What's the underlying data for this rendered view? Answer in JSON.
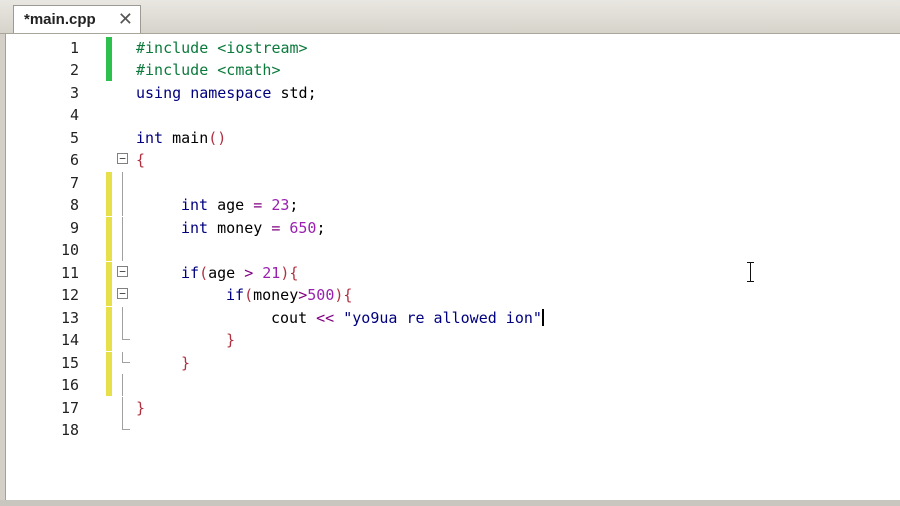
{
  "tab": {
    "title": "*main.cpp",
    "close_glyph": "✕"
  },
  "lines": [
    {
      "n": "1",
      "marker": "green"
    },
    {
      "n": "2",
      "marker": "green"
    },
    {
      "n": "3",
      "marker": ""
    },
    {
      "n": "4",
      "marker": ""
    },
    {
      "n": "5",
      "marker": ""
    },
    {
      "n": "6",
      "marker": ""
    },
    {
      "n": "7",
      "marker": "yellow"
    },
    {
      "n": "8",
      "marker": "yellow"
    },
    {
      "n": "9",
      "marker": "yellow"
    },
    {
      "n": "10",
      "marker": "yellow"
    },
    {
      "n": "11",
      "marker": "yellow"
    },
    {
      "n": "12",
      "marker": "yellow"
    },
    {
      "n": "13",
      "marker": "yellow"
    },
    {
      "n": "14",
      "marker": "yellow"
    },
    {
      "n": "15",
      "marker": "yellow"
    },
    {
      "n": "16",
      "marker": "yellow"
    },
    {
      "n": "17",
      "marker": ""
    },
    {
      "n": "18",
      "marker": ""
    }
  ],
  "code": {
    "l1_a": "#include",
    "l1_b": " <iostream>",
    "l2_a": "#include",
    "l2_b": " <cmath>",
    "l3_a": "using",
    "l3_b": " ",
    "l3_c": "namespace",
    "l3_d": " std;",
    "l5_a": "int",
    "l5_b": " main",
    "l5_c": "()",
    "l6_a": "{",
    "l8_a": "int",
    "l8_b": " age ",
    "l8_c": "=",
    "l8_d": " ",
    "l8_e": "23",
    "l8_f": ";",
    "l9_a": "int",
    "l9_b": " money ",
    "l9_c": "=",
    "l9_d": " ",
    "l9_e": "650",
    "l9_f": ";",
    "l11_a": "if",
    "l11_b": "(",
    "l11_c": "age ",
    "l11_d": ">",
    "l11_e": " ",
    "l11_f": "21",
    "l11_g": "){",
    "l12_a": "if",
    "l12_b": "(",
    "l12_c": "money",
    "l12_d": ">",
    "l12_e": "500",
    "l12_f": "){",
    "l13_a": "cout",
    "l13_b": " ",
    "l13_c": "<<",
    "l13_d": " ",
    "l13_e": "\"yo9ua re allowed ion\"",
    "l14_a": "}",
    "l15_a": "}",
    "l17_a": "}"
  },
  "colors": {
    "keyword": "#00007f",
    "preprocessor": "#0b7a3c",
    "number": "#9a20b0",
    "brace": "#b03040",
    "saved_marker": "#2ec04f",
    "unsaved_marker": "#e8e04a"
  },
  "icons": [
    "close-icon",
    "fold-minus-icon",
    "ibeam-cursor-icon"
  ]
}
